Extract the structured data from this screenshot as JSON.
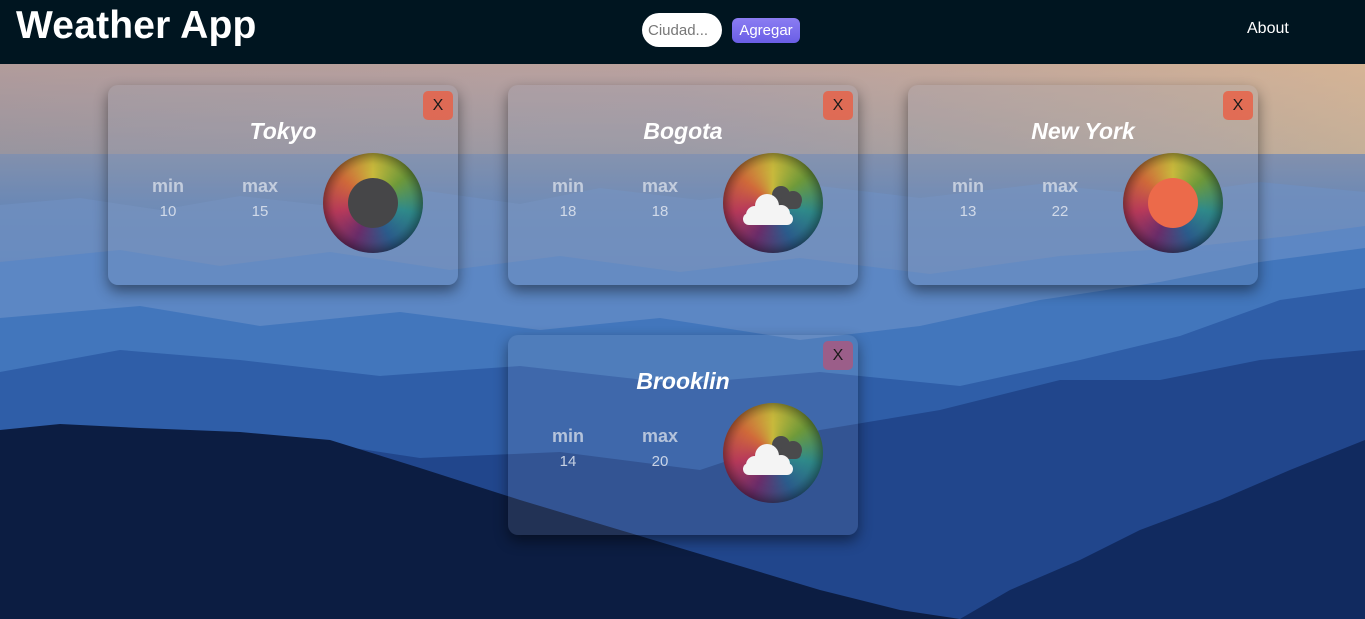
{
  "navbar": {
    "title": "Weather App",
    "search_placeholder": "Ciudad...",
    "add_label": "Agregar",
    "about_label": "About"
  },
  "cards": [
    {
      "city": "Tokyo",
      "min_label": "min",
      "max_label": "max",
      "min": "10",
      "max": "15",
      "close_label": "X",
      "icon": "dark-circle-icon"
    },
    {
      "city": "Bogota",
      "min_label": "min",
      "max_label": "max",
      "min": "18",
      "max": "18",
      "close_label": "X",
      "icon": "broken-clouds-icon"
    },
    {
      "city": "New York",
      "min_label": "min",
      "max_label": "max",
      "min": "13",
      "max": "22",
      "close_label": "X",
      "icon": "sun-icon"
    },
    {
      "city": "Brooklin",
      "min_label": "min",
      "max_label": "max",
      "min": "14",
      "max": "20",
      "close_label": "X",
      "icon": "broken-clouds-icon"
    }
  ],
  "colors": {
    "navbar": "#001520",
    "add_button": "#7a6ef0",
    "close_button": "#e86248",
    "sun": "#ec6a4a",
    "dark_circle": "#464648"
  }
}
